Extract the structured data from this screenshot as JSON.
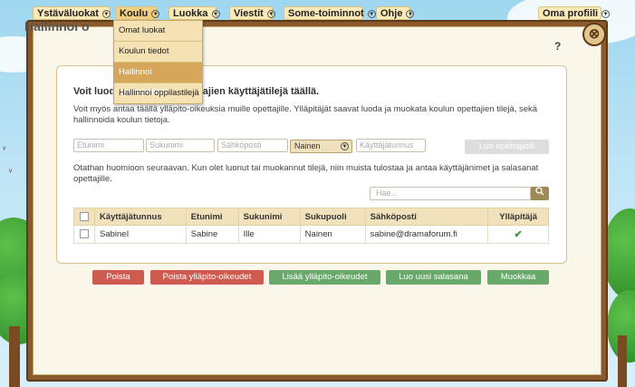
{
  "nav": {
    "items": [
      {
        "label": "Ystäväluokat"
      },
      {
        "label": "Koulu"
      },
      {
        "label": "Luokka"
      },
      {
        "label": "Viestit"
      },
      {
        "label": "Some-toiminnot"
      },
      {
        "label": "Ohje"
      },
      {
        "label": "Oma profiili"
      }
    ]
  },
  "dropdown": {
    "items": [
      {
        "label": "Omat luokat"
      },
      {
        "label": "Koulun tiedot"
      },
      {
        "label": "Hallinnoi opettajatilejä"
      },
      {
        "label": "Hallinnoi oppilastilejä"
      }
    ]
  },
  "page": {
    "title": "Hallinnoi o",
    "help": "?",
    "close": "⊗",
    "heading": "Voit luoda ja muokata opettajien käyttäjätilejä täällä.",
    "description": "Voit myös antaa täällä ylläpito-oikeuksia muille opettajille. Ylläpitäjät saavat luoda ja muokata koulun opettajien tilejä, sekä hallinnoida koulun tietoja.",
    "note": "Otathan huomioon seuraavan. Kun olet luonut tai muokannut tilejä, niin muista tulostaa ja antaa käyttäjänimet ja salasanat opettajille."
  },
  "form": {
    "firstname_placeholder": "Etunimi",
    "lastname_placeholder": "Sukunimi",
    "email_placeholder": "Sähköposti",
    "gender_value": "Nainen",
    "username_placeholder": "Käyttäjätunnus",
    "create_label": "Luo opettajatili"
  },
  "search": {
    "placeholder": "Hae..."
  },
  "table": {
    "headers": [
      "Käyttäjätunnus",
      "Etunimi",
      "Sukunimi",
      "Sukupuoli",
      "Sähköposti",
      "Ylläpitäjä"
    ],
    "rows": [
      {
        "username": "SabineI",
        "firstname": "Sabine",
        "lastname": "Ille",
        "gender": "Nainen",
        "email": "sabine@dramaforum.fi",
        "admin": "✔"
      }
    ]
  },
  "actions": {
    "delete": "Poista",
    "remove_admin": "Poista ylläpito-oikeudet",
    "add_admin": "Lisää ylläpito-oikeudet",
    "new_password": "Luo uusi salasana",
    "edit": "Muokkaa"
  }
}
